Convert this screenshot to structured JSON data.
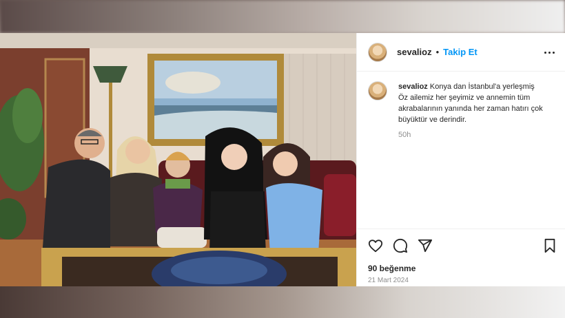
{
  "post": {
    "username": "sevalioz",
    "separator": "•",
    "follow_label": "Takip Et",
    "more_icon": "more-options-icon",
    "caption_username": "sevalioz",
    "caption_text": "Konya dan İstanbul'a yerleşmiş Öz ailemiz her şeyimiz ve annemin tüm akrabalarının yanında her zaman hatırı çok büyüktür ve derindir.",
    "time_ago": "50h",
    "likes": "90 beğenme",
    "date": "21 Mart 2024",
    "icons": [
      "heart-icon",
      "comment-icon",
      "share-icon",
      "bookmark-icon"
    ]
  },
  "colors": {
    "follow_blue": "#0095f6",
    "text": "#262626",
    "muted": "#8e8e8e",
    "divider": "#efefef"
  }
}
